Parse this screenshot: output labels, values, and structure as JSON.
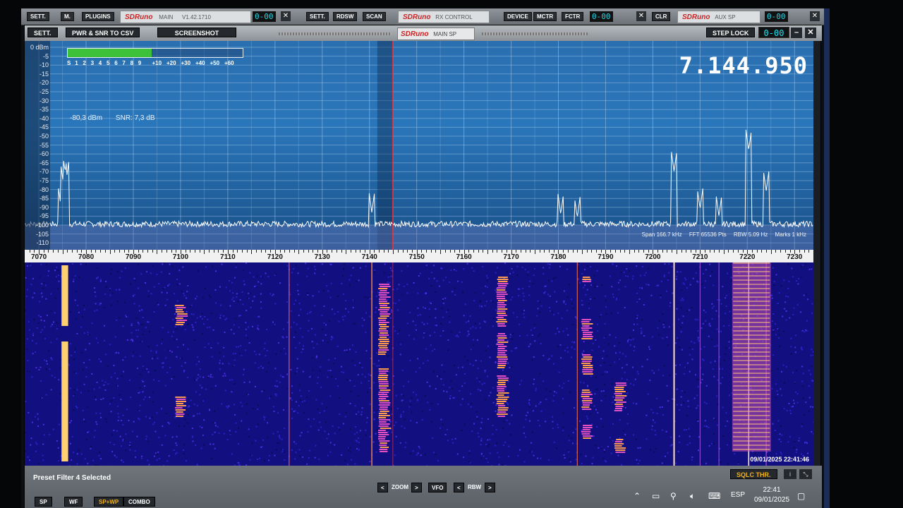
{
  "back_windows": {
    "buttons": [
      "SETT.",
      "M.",
      "PLUGINS",
      "SETT.",
      "RDSW",
      "SCAN",
      "DEVICE",
      "MCTR",
      "FCTR",
      "CLR"
    ],
    "titles": [
      {
        "brand": "SDRuno",
        "name": "MAIN",
        "version": "V1.42.1710"
      },
      {
        "brand": "SDRuno",
        "name": "RX CONTROL"
      },
      {
        "brand": "SDRuno",
        "name": "AUX SP"
      }
    ],
    "digits": [
      "0-00",
      "0-00",
      "0-00"
    ]
  },
  "window": {
    "title_brand": "SDRuno",
    "title_name": "MAIN SP",
    "toolbar": {
      "sett": "SETT.",
      "pwr_snr": "PWR & SNR TO CSV",
      "screenshot": "SCREENSHOT",
      "step_lock": "STEP LOCK",
      "digit": "0-00",
      "min": "–",
      "close": "✕"
    }
  },
  "spectrum": {
    "y_labels": [
      "0 dBm",
      "-5",
      "-10",
      "-15",
      "-20",
      "-25",
      "-30",
      "-35",
      "-40",
      "-45",
      "-50",
      "-55",
      "-60",
      "-65",
      "-70",
      "-75",
      "-80",
      "-85",
      "-90",
      "-95",
      "-100",
      "-105",
      "-110"
    ],
    "smeter": {
      "level_fraction": 0.48,
      "scale": [
        "S",
        "1",
        "2",
        "3",
        "4",
        "5",
        "6",
        "7",
        "8",
        "9",
        "+10",
        "+20",
        "+30",
        "+40",
        "+50",
        "+60"
      ]
    },
    "power": "-80,3 dBm",
    "snr": "SNR: 7,3 dB",
    "frequency": "7.144.950",
    "status": {
      "span": "Span 166.7 kHz",
      "fft": "FFT 65536 Pts",
      "rbw": "RBW 5.09 Hz",
      "marks": "Marks 1 kHz"
    },
    "freq_axis": [
      "7070",
      "7080",
      "7090",
      "7100",
      "7110",
      "7120",
      "7130",
      "7140",
      "7150",
      "7160",
      "7170",
      "7180",
      "7190",
      "7200",
      "7210",
      "7220",
      "7230"
    ],
    "vfo_khz": 7144.95,
    "range_khz": [
      7067,
      7234
    ]
  },
  "waterfall": {
    "datetime": "09/01/2025 22:41:46"
  },
  "bottom": {
    "preset": "Preset Filter 4 Selected",
    "sqlc": "SQLC THR.",
    "sq_small": [
      "i",
      "⤡"
    ],
    "mode_buttons": [
      "SP",
      "WF",
      "SP+WP",
      "COMBO"
    ],
    "zoom": "ZOOM",
    "vfo": "VFO",
    "rbw": "RBW",
    "arrow_left": "<",
    "arrow_right": ">"
  },
  "taskbar": {
    "lang": "ESP",
    "time": "22:41",
    "date": "09/01/2025",
    "icons": [
      "chevron-up-icon",
      "battery-icon",
      "network-icon",
      "volume-icon",
      "keyboard-icon",
      "notification-icon"
    ]
  },
  "colors": {
    "spectrum_bg": "#2a72b6",
    "waterfall_bg": "#120f80",
    "smeter_green": "#3ec13a",
    "vfo_line": "#ff3030",
    "accent_orange": "#f3b21a",
    "digit_cyan": "#22e0f0"
  }
}
